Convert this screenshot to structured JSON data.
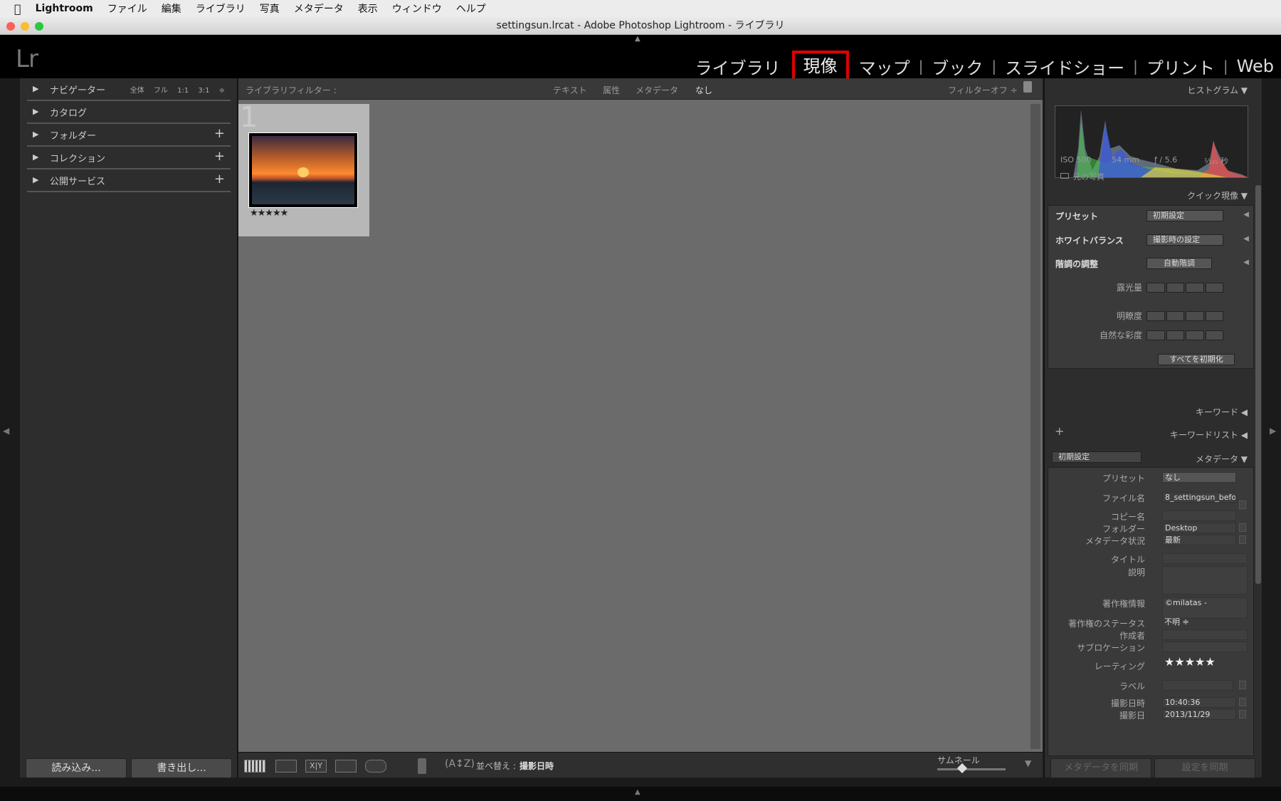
{
  "menubar": {
    "app": "Lightroom",
    "items": [
      "ファイル",
      "編集",
      "ライブラリ",
      "写真",
      "メタデータ",
      "表示",
      "ウィンドウ",
      "ヘルプ"
    ]
  },
  "window": {
    "title": "settingsun.lrcat - Adobe Photoshop Lightroom - ライブラリ"
  },
  "header": {
    "logo": "Lr",
    "modules": [
      "ライブラリ",
      "現像",
      "マップ",
      "ブック",
      "スライドショー",
      "プリント",
      "Web"
    ],
    "separator": "|",
    "highlight_color": "#e00000"
  },
  "left": {
    "navigator": "ナビゲーター",
    "navigator_opts": "全体 フル 1:1 3:1 ≑",
    "catalog": "カタログ",
    "folders": "フォルダー",
    "collections": "コレクション",
    "publish": "公開サービス",
    "import_btn": "読み込み...",
    "export_btn": "書き出し..."
  },
  "filter": {
    "label": "ライブラリフィルター :",
    "text": "テキスト",
    "attr": "属性",
    "meta": "メタデータ",
    "none": "なし",
    "off": "フィルターオフ ÷"
  },
  "grid": {
    "index": "1",
    "rating": "★★★★★"
  },
  "toolbar": {
    "sort_label": "並べ替え :",
    "sort_value": "撮影日時",
    "thumb_label": "サムネール"
  },
  "right": {
    "histogram": "ヒストグラム",
    "iso": "ISO 500",
    "focal": "54 mm",
    "aperture": "ƒ / 5.6",
    "shutter": "¹⁄₁₂₅ 秒",
    "original": "元の写真",
    "quick_develop": "クイック現像",
    "preset_label": "プリセット",
    "preset_value": "初期設定",
    "wb_label": "ホワイトバランス",
    "wb_value": "撮影時の設定",
    "tone_label": "階調の調整",
    "auto_tone": "自動階調",
    "exposure": "露光量",
    "clarity": "明瞭度",
    "vibrance": "自然な彩度",
    "reset_all": "すべてを初期化",
    "keywording": "キーワード",
    "keyword_list": "キーワードリスト",
    "metadata": "メタデータ",
    "metadata_preset_select": "初期設定",
    "meta": {
      "preset_label": "プリセット",
      "preset_value": "なし",
      "filename_label": "ファイル名",
      "filename_value": "8_settingsun_befo",
      "copyname_label": "コピー名",
      "folder_label": "フォルダー",
      "folder_value": "Desktop",
      "status_label": "メタデータ状況",
      "status_value": "最新",
      "title_label": "タイトル",
      "caption_label": "説明",
      "copyright_label": "著作権情報",
      "copyright_value": "©milatas -",
      "copyright_status_label": "著作権のステータス",
      "copyright_status_value": "不明 ≑",
      "creator_label": "作成者",
      "sublocation_label": "サブロケーション",
      "rating_label": "レーティング",
      "rating_value": "★★★★★",
      "label_label": "ラベル",
      "capture_time_label": "撮影日時",
      "capture_time_value": "10:40:36",
      "capture_date_label": "撮影日",
      "capture_date_value": "2013/11/29"
    },
    "sync_meta": "メタデータを同期",
    "sync_settings": "設定を同期"
  }
}
